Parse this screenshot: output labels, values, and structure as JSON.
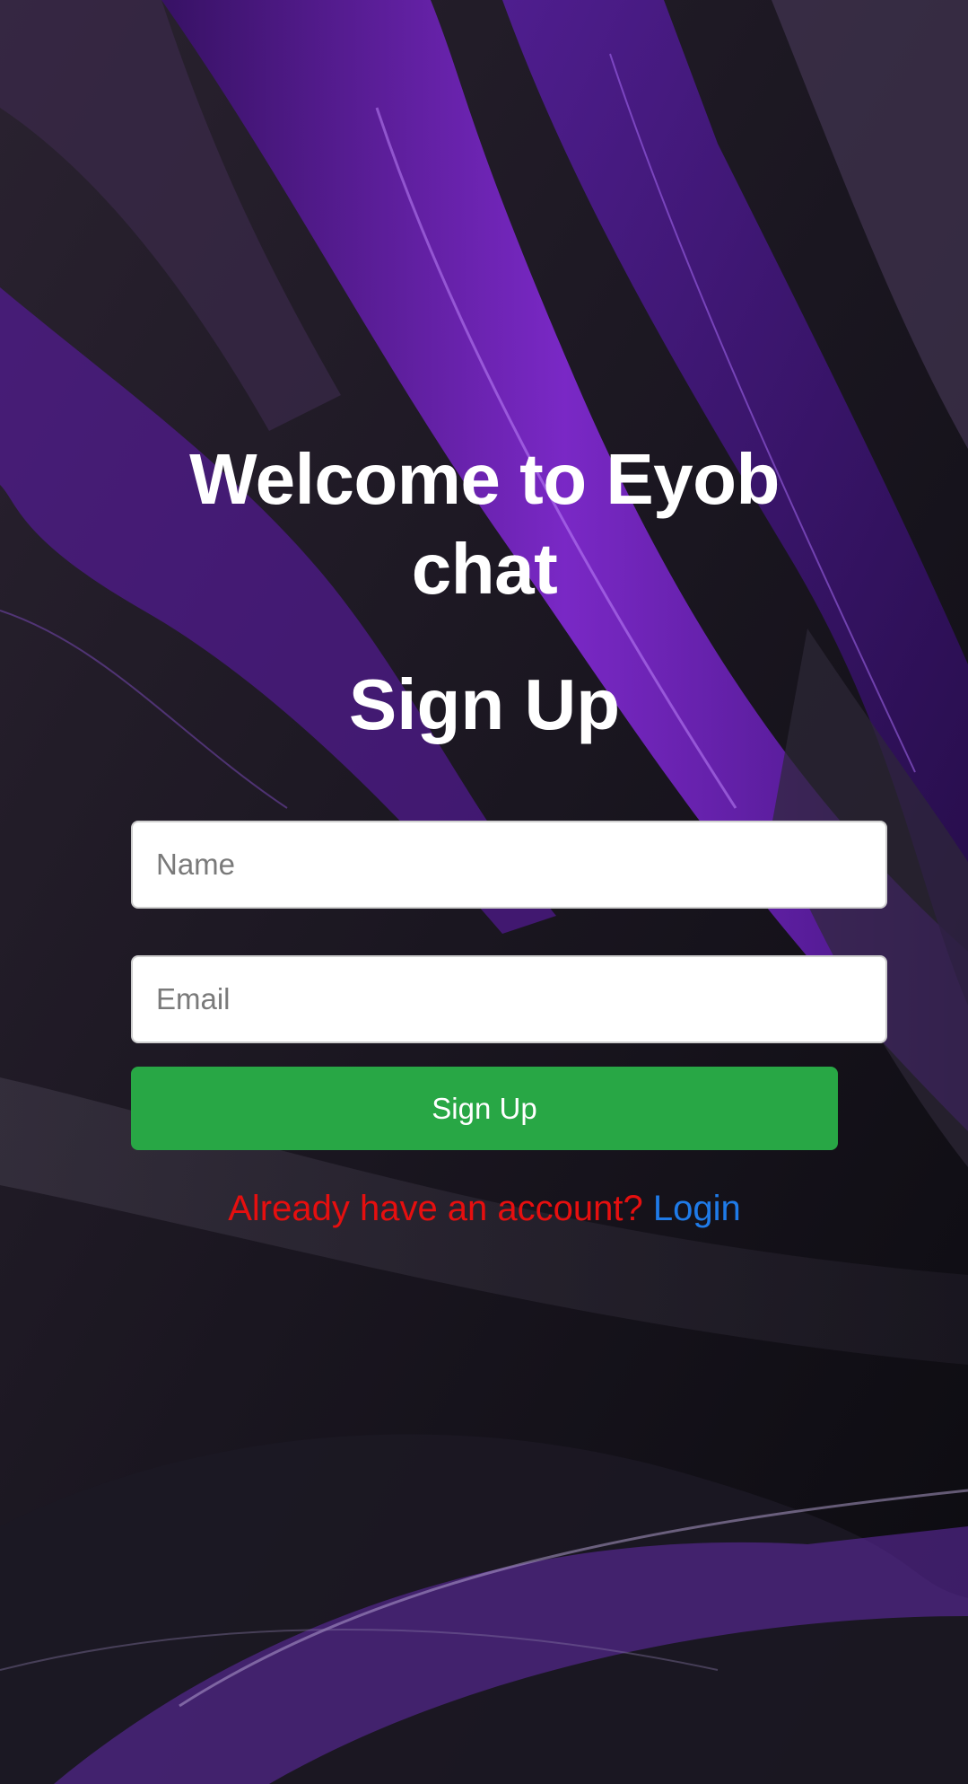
{
  "page": {
    "welcome_title": "Welcome to Eyob chat",
    "form_title": "Sign Up"
  },
  "form": {
    "name_placeholder": "Name",
    "name_value": "",
    "email_placeholder": "Email",
    "email_value": "",
    "submit_label": "Sign Up"
  },
  "footer": {
    "prompt_text": "Already have an account?",
    "login_label": "Login"
  },
  "colors": {
    "button_green": "#28a745",
    "prompt_red": "#e60f0f",
    "link_blue": "#1f7be8",
    "accent_purple": "#8a2be2"
  }
}
